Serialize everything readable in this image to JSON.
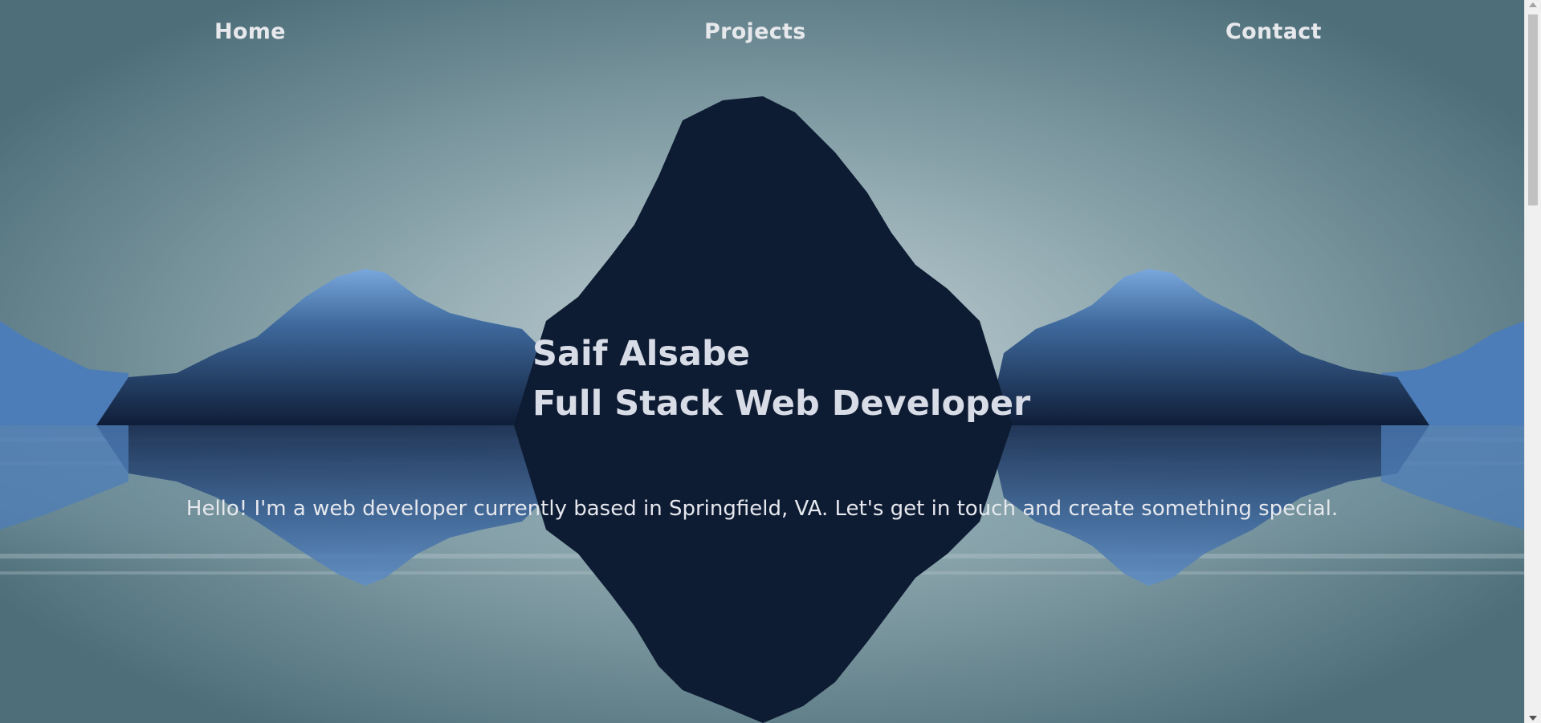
{
  "nav": {
    "home": "Home",
    "projects": "Projects",
    "contact": "Contact"
  },
  "hero": {
    "name": "Saif Alsabe",
    "role": "Full Stack Web Developer",
    "intro": "Hello! I'm a web developer currently based in Springfield, VA. Let's get in touch and create something special."
  },
  "colors": {
    "sky": "#5b7b86",
    "sky_glow": "#b4c6cb",
    "mountain_dark": "#0d1b33",
    "mountain_highlight": "#3f6a9e",
    "text": "#e6e8ec"
  }
}
